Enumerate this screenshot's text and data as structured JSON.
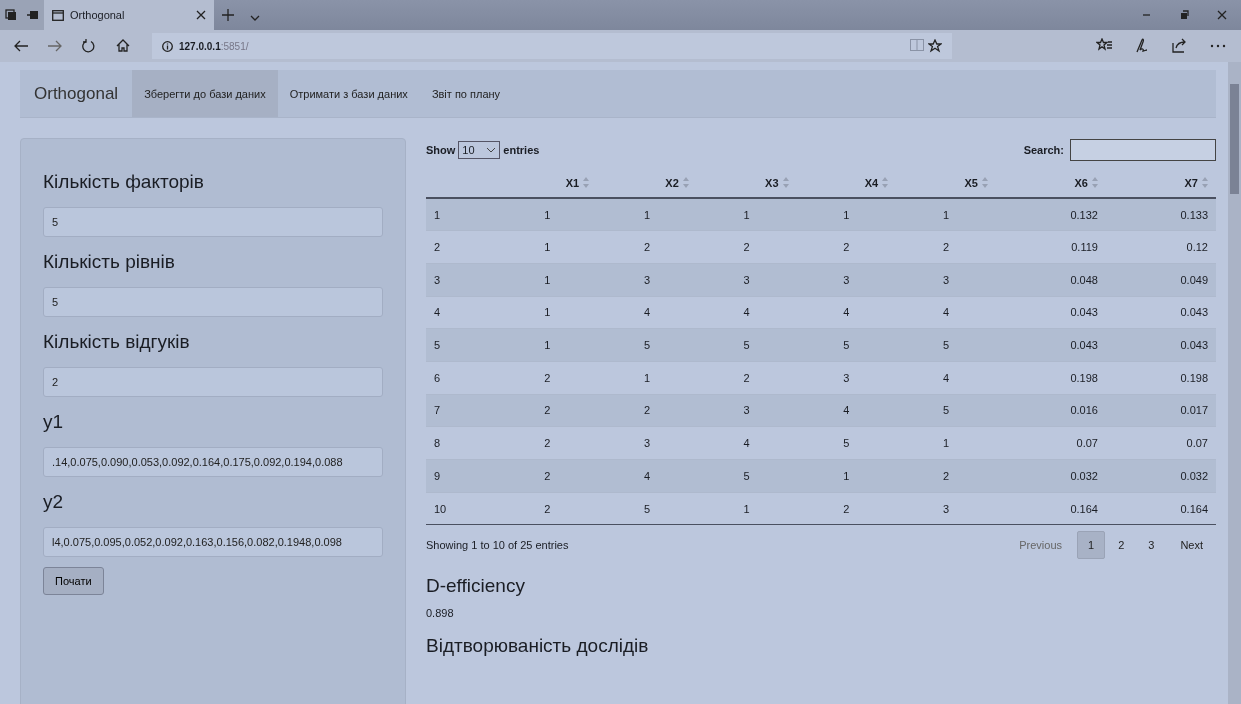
{
  "browser": {
    "tab_title": "Orthogonal",
    "url_host": "127.0.0.1",
    "url_rest": ":5851/"
  },
  "navbar": {
    "brand": "Orthogonal",
    "items": [
      {
        "label": "Зберегти до бази даних",
        "selected": true
      },
      {
        "label": "Отримати з бази даних",
        "selected": false
      },
      {
        "label": "Звіт по плану",
        "selected": false
      }
    ]
  },
  "form": {
    "fields": [
      {
        "label": "Кількість факторів",
        "value": "5"
      },
      {
        "label": "Кількість рівнів",
        "value": "5"
      },
      {
        "label": "Кількість відгуків",
        "value": "2"
      },
      {
        "label": "y1",
        "value": ".14,0.075,0.090,0.053,0.092,0.164,0.175,0.092,0.194,0.088"
      },
      {
        "label": "y2",
        "value": "l4,0.075,0.095,0.052,0.092,0.163,0.156,0.082,0.1948,0.098"
      }
    ],
    "button": "Почати"
  },
  "table": {
    "length_label_before": "Show",
    "length_value": "10",
    "length_label_after": "entries",
    "search_label": "Search:",
    "columns": [
      "",
      "X1",
      "X2",
      "X3",
      "X4",
      "X5",
      "X6",
      "X7"
    ],
    "rows": [
      [
        "1",
        "1",
        "1",
        "1",
        "1",
        "1",
        "0.132",
        "0.133"
      ],
      [
        "2",
        "1",
        "2",
        "2",
        "2",
        "2",
        "0.119",
        "0.12"
      ],
      [
        "3",
        "1",
        "3",
        "3",
        "3",
        "3",
        "0.048",
        "0.049"
      ],
      [
        "4",
        "1",
        "4",
        "4",
        "4",
        "4",
        "0.043",
        "0.043"
      ],
      [
        "5",
        "1",
        "5",
        "5",
        "5",
        "5",
        "0.043",
        "0.043"
      ],
      [
        "6",
        "2",
        "1",
        "2",
        "3",
        "4",
        "0.198",
        "0.198"
      ],
      [
        "7",
        "2",
        "2",
        "3",
        "4",
        "5",
        "0.016",
        "0.017"
      ],
      [
        "8",
        "2",
        "3",
        "4",
        "5",
        "1",
        "0.07",
        "0.07"
      ],
      [
        "9",
        "2",
        "4",
        "5",
        "1",
        "2",
        "0.032",
        "0.032"
      ],
      [
        "10",
        "2",
        "5",
        "1",
        "2",
        "3",
        "0.164",
        "0.164"
      ]
    ],
    "info": "Showing 1 to 10 of 25 entries",
    "pagination": [
      {
        "label": "Previous",
        "kind": "nav",
        "disabled": true,
        "selected": false
      },
      {
        "label": "1",
        "kind": "page",
        "disabled": false,
        "selected": true
      },
      {
        "label": "2",
        "kind": "page",
        "disabled": false,
        "selected": false
      },
      {
        "label": "3",
        "kind": "page",
        "disabled": false,
        "selected": false
      },
      {
        "label": "Next",
        "kind": "nav",
        "disabled": false,
        "selected": false
      }
    ]
  },
  "results": [
    {
      "title": "D-efficiency",
      "value": "0.898"
    },
    {
      "title": "Відтворюваність дослідів"
    }
  ]
}
